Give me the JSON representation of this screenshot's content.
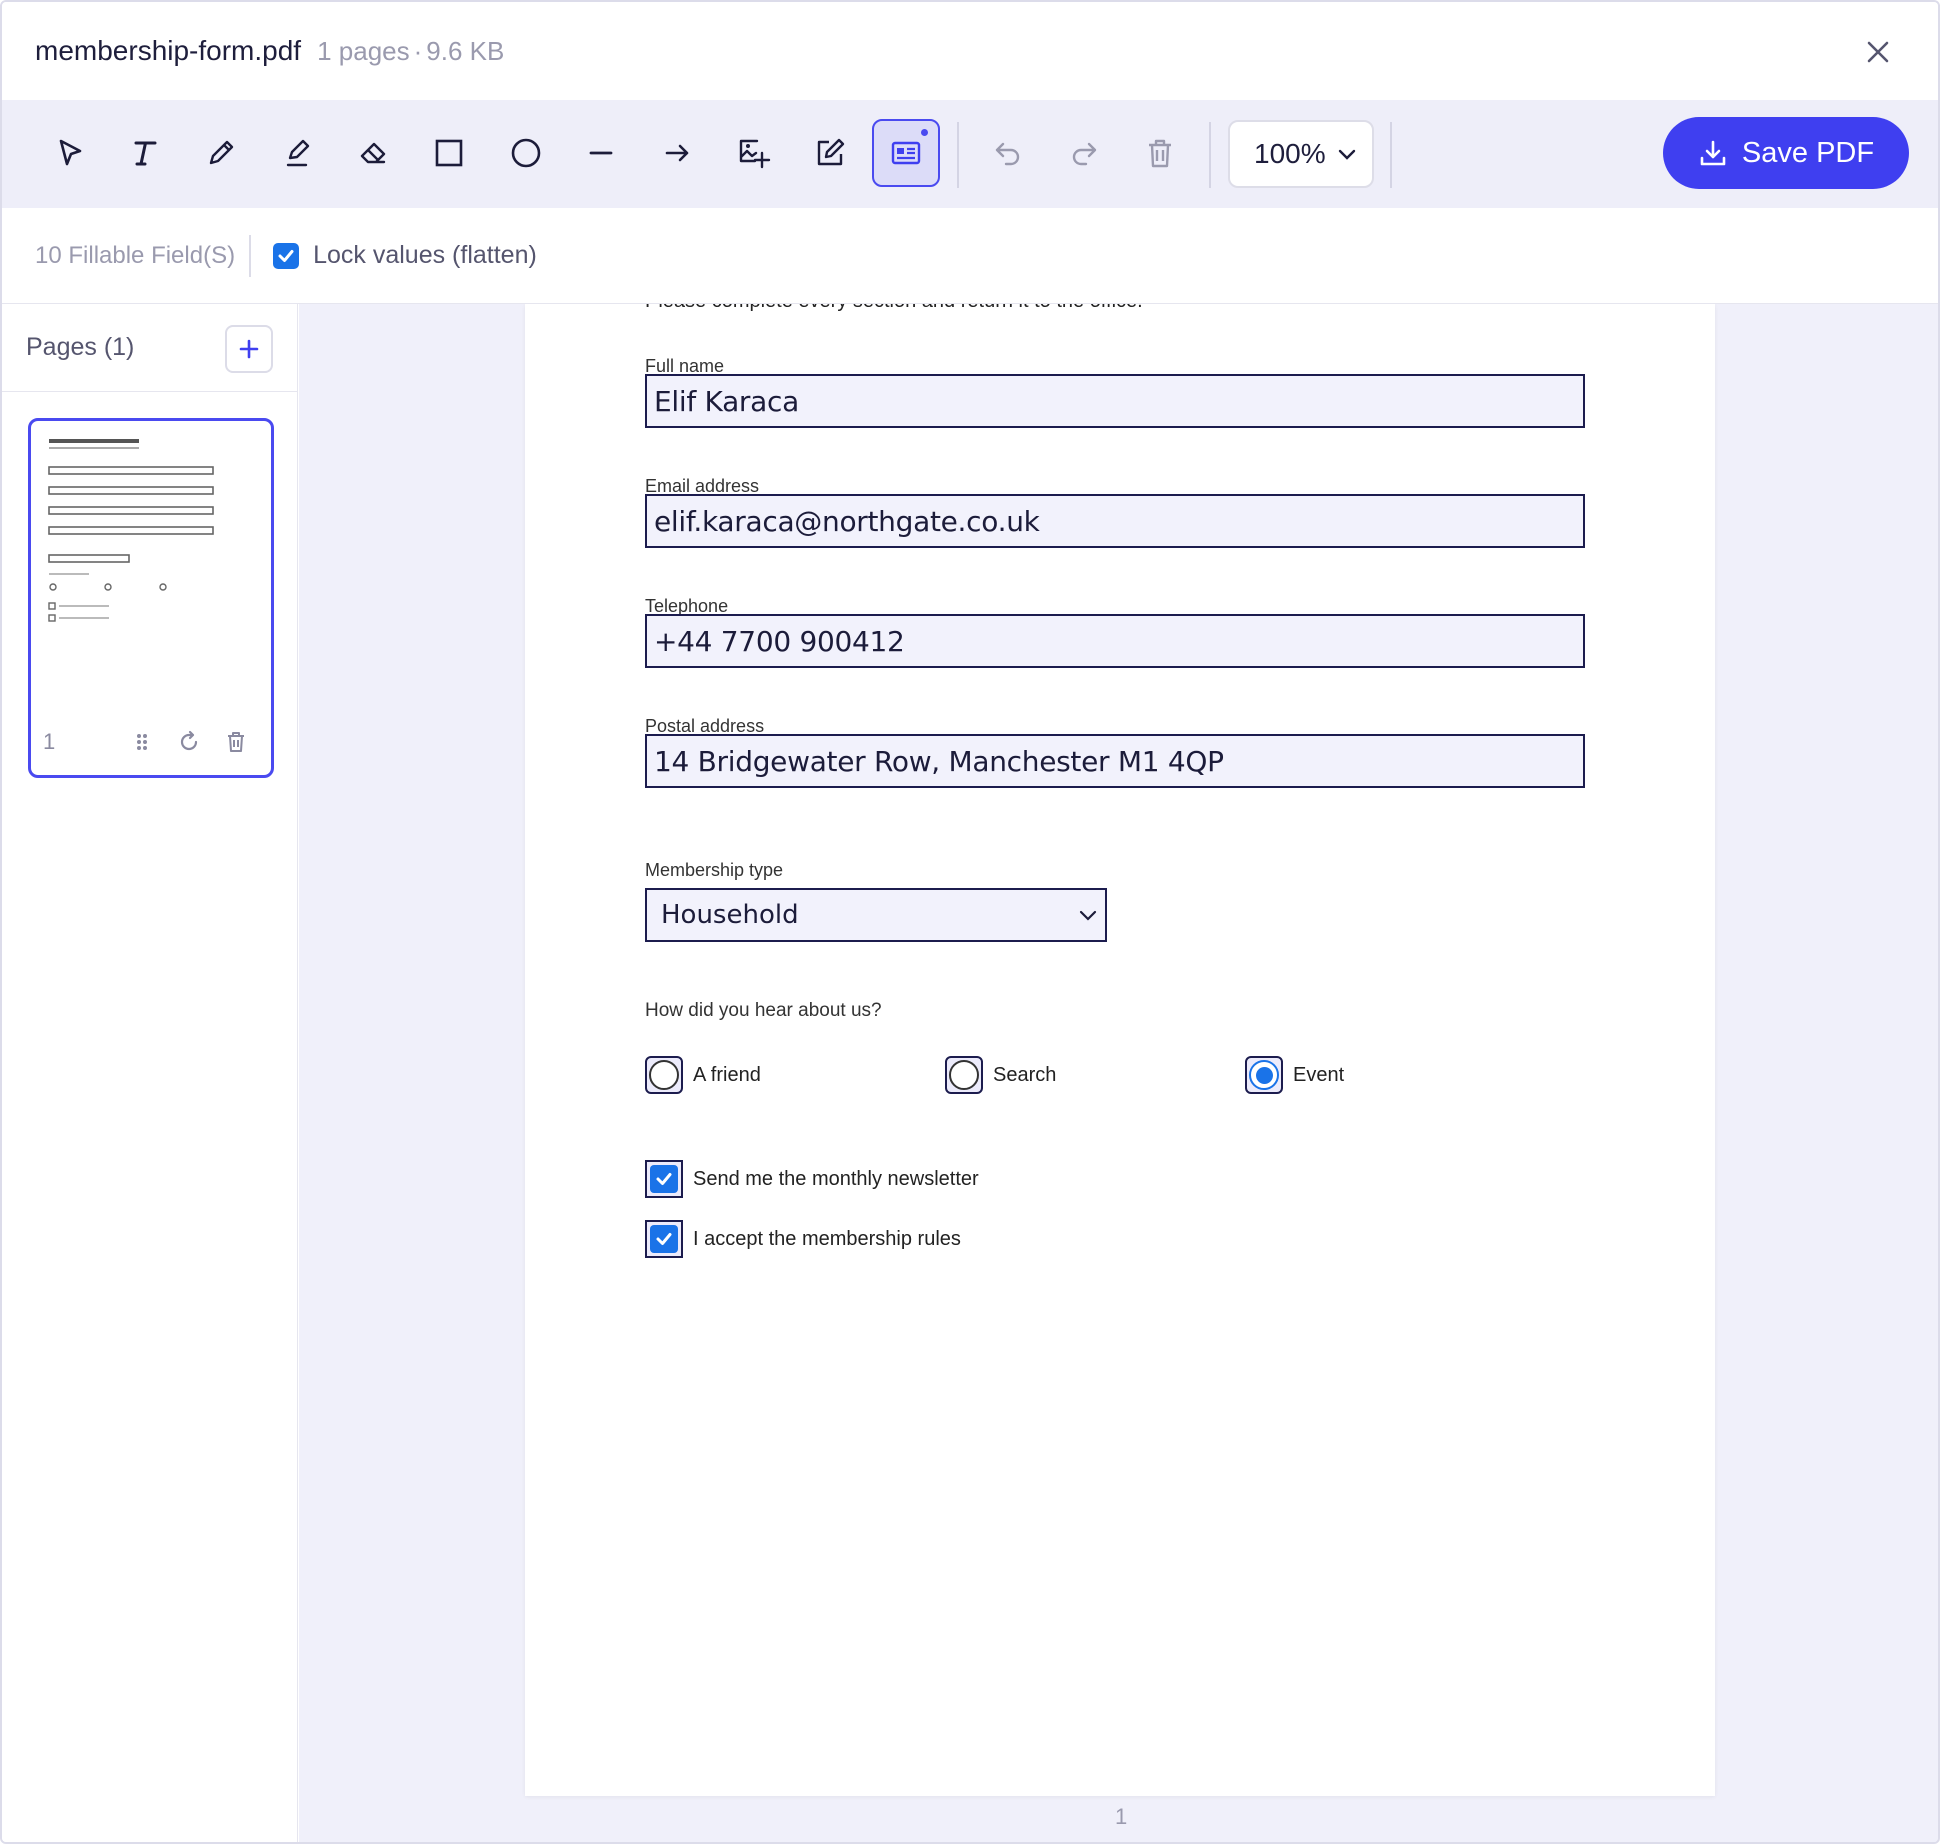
{
  "titlebar": {
    "filename": "membership-form.pdf",
    "page_count": "1 pages",
    "separator": "·",
    "file_size": "9.6 KB"
  },
  "toolbar": {
    "tools": [
      "select-icon",
      "text-icon",
      "pen-icon",
      "highlighter-icon",
      "eraser-icon",
      "rectangle-icon",
      "ellipse-icon",
      "line-icon",
      "arrow-icon",
      "image-add-icon",
      "edit-icon",
      "form-field-icon"
    ],
    "active_tool": "form-field-icon",
    "zoom": "100%",
    "save_label": "Save PDF"
  },
  "subbar": {
    "fields_count": "10 Fillable Field(S)",
    "lock_label": "Lock values (flatten)",
    "lock_checked": true
  },
  "sidebar": {
    "pages_title": "Pages (1)",
    "thumb_page_number": "1"
  },
  "document": {
    "intro": "Please complete every section and return it to the office.",
    "fields": {
      "full_name": {
        "label": "Full name",
        "value": "Elif Karaca"
      },
      "email": {
        "label": "Email address",
        "value": "elif.karaca@northgate.co.uk"
      },
      "telephone": {
        "label": "Telephone",
        "value": "+44 7700 900412"
      },
      "postal": {
        "label": "Postal address",
        "value": "14 Bridgewater Row, Manchester M1 4QP"
      },
      "membership": {
        "label": "Membership type",
        "value": "Household"
      }
    },
    "hear_question": "How did you hear about us?",
    "radio_options": [
      "A friend",
      "Search",
      "Event"
    ],
    "radio_selected": "Event",
    "checkboxes": [
      {
        "label": "Send me the monthly newsletter",
        "checked": true
      },
      {
        "label": "I accept the membership rules",
        "checked": true
      }
    ],
    "page_number": "1"
  },
  "colors": {
    "accent": "#3f3ff0",
    "toolbar_bg": "#eeeef9",
    "canvas_bg": "#f0f0fa",
    "checkbox_blue": "#1a73e8"
  }
}
